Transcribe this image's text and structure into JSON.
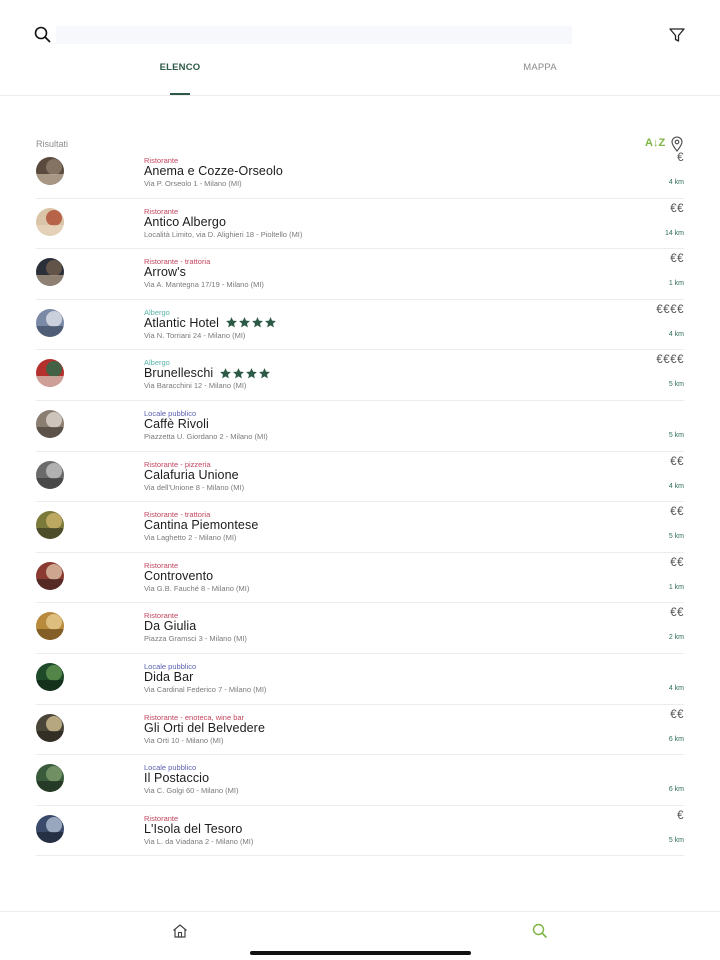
{
  "search": {
    "value": "",
    "placeholder": ""
  },
  "icons": {
    "search": "search-icon",
    "filter": "filter-icon",
    "sort_location": "location-pin-icon",
    "nav_home": "home-icon",
    "nav_search": "search-icon",
    "rating_star": "star-icon"
  },
  "colors": {
    "accent": "#2c5a46",
    "sort_accent": "#7cb342",
    "category_restaurant": "#c2455e",
    "category_hotel": "#5ab4a8",
    "category_public": "#5b5fb0",
    "distance": "#2c6a58"
  },
  "tabs": [
    {
      "label": "ELENCO",
      "active": true
    },
    {
      "label": "MAPPA",
      "active": false
    }
  ],
  "results": {
    "label": "Risultati",
    "sort_label": "A↓Z"
  },
  "items": [
    {
      "category": "Ristorante",
      "category_type": "restaurant",
      "name": "Anema e Cozze-Orseolo",
      "address": "Via P. Orseolo 1 - Milano (MI)",
      "price": "€",
      "distance": "4 km",
      "stars": 0
    },
    {
      "category": "Ristorante",
      "category_type": "restaurant",
      "name": "Antico Albergo",
      "address": "Località Limito, via D. Alighieri 18 - Pioltello (MI)",
      "price": "€€",
      "distance": "14 km",
      "stars": 0
    },
    {
      "category": "Ristorante - trattoria",
      "category_type": "restaurant",
      "name": "Arrow's",
      "address": "Via A. Mantegna 17/19 - Milano (MI)",
      "price": "€€",
      "distance": "1 km",
      "stars": 0
    },
    {
      "category": "Albergo",
      "category_type": "hotel",
      "name": "Atlantic Hotel",
      "address": "Via N. Torriani 24 - Milano (MI)",
      "price": "€€€€",
      "distance": "4 km",
      "stars": 4
    },
    {
      "category": "Albergo",
      "category_type": "hotel",
      "name": "Brunelleschi",
      "address": "Via Baracchini 12 - Milano (MI)",
      "price": "€€€€",
      "distance": "5 km",
      "stars": 4
    },
    {
      "category": "Locale pubblico",
      "category_type": "public",
      "name": "Caffè Rivoli",
      "address": "Piazzetta U. Giordano 2 - Milano (MI)",
      "price": "",
      "distance": "5 km",
      "stars": 0
    },
    {
      "category": "Ristorante - pizzeria",
      "category_type": "restaurant",
      "name": "Calafuria Unione",
      "address": "Via dell'Unione 8 - Milano (MI)",
      "price": "€€",
      "distance": "4 km",
      "stars": 0
    },
    {
      "category": "Ristorante - trattoria",
      "category_type": "restaurant",
      "name": "Cantina Piemontese",
      "address": "Via Laghetto 2 - Milano (MI)",
      "price": "€€",
      "distance": "5 km",
      "stars": 0
    },
    {
      "category": "Ristorante",
      "category_type": "restaurant",
      "name": "Controvento",
      "address": "Via G.B. Fauché 8 - Milano (MI)",
      "price": "€€",
      "distance": "1 km",
      "stars": 0
    },
    {
      "category": "Ristorante",
      "category_type": "restaurant",
      "name": "Da Giulia",
      "address": "Piazza Gramsci 3 - Milano (MI)",
      "price": "€€",
      "distance": "2 km",
      "stars": 0
    },
    {
      "category": "Locale pubblico",
      "category_type": "public",
      "name": "Dida Bar",
      "address": "Via Cardinal Federico 7 - Milano (MI)",
      "price": "",
      "distance": "4 km",
      "stars": 0
    },
    {
      "category": "Ristorante - enoteca, wine bar",
      "category_type": "restaurant",
      "name": "Gli Orti del Belvedere",
      "address": "Via Orti 10 - Milano (MI)",
      "price": "€€",
      "distance": "6 km",
      "stars": 0
    },
    {
      "category": "Locale pubblico",
      "category_type": "public",
      "name": "Il Postaccio",
      "address": "Via C. Golgi 60 - Milano (MI)",
      "price": "",
      "distance": "6 km",
      "stars": 0
    },
    {
      "category": "Ristorante",
      "category_type": "restaurant",
      "name": "L'Isola del Tesoro",
      "address": "Via L. da Viadana 2 - Milano (MI)",
      "price": "€",
      "distance": "5 km",
      "stars": 0
    }
  ]
}
